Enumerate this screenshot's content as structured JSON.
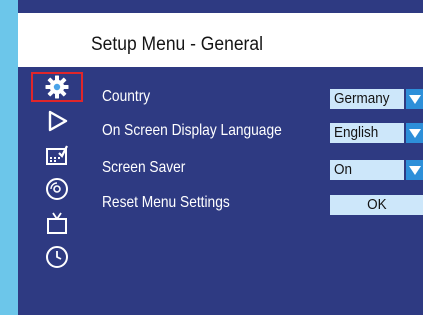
{
  "header": {
    "title": "Setup Menu - General"
  },
  "sidebar": {
    "items": [
      {
        "icon": "gear-icon",
        "selected": true
      },
      {
        "icon": "play-icon",
        "selected": false
      },
      {
        "icon": "audio-setup-icon",
        "selected": false
      },
      {
        "icon": "disc-icon",
        "selected": false
      },
      {
        "icon": "tv-icon",
        "selected": false
      },
      {
        "icon": "clock-icon",
        "selected": false
      }
    ]
  },
  "settings": {
    "rows": [
      {
        "label": "Country",
        "value": "Germany",
        "dropdown": true
      },
      {
        "label": "On Screen Display Language",
        "value": "English",
        "dropdown": true
      },
      {
        "label": "Screen Saver",
        "value": "On",
        "dropdown": true
      },
      {
        "label": "Reset Menu Settings",
        "value": "OK",
        "dropdown": false
      }
    ]
  },
  "colors": {
    "background": "#6cc6ea",
    "panel": "#2e3a82",
    "value_box": "#cde7fa",
    "arrow_button": "#2d8fd9",
    "selection_border": "#e1262a"
  }
}
